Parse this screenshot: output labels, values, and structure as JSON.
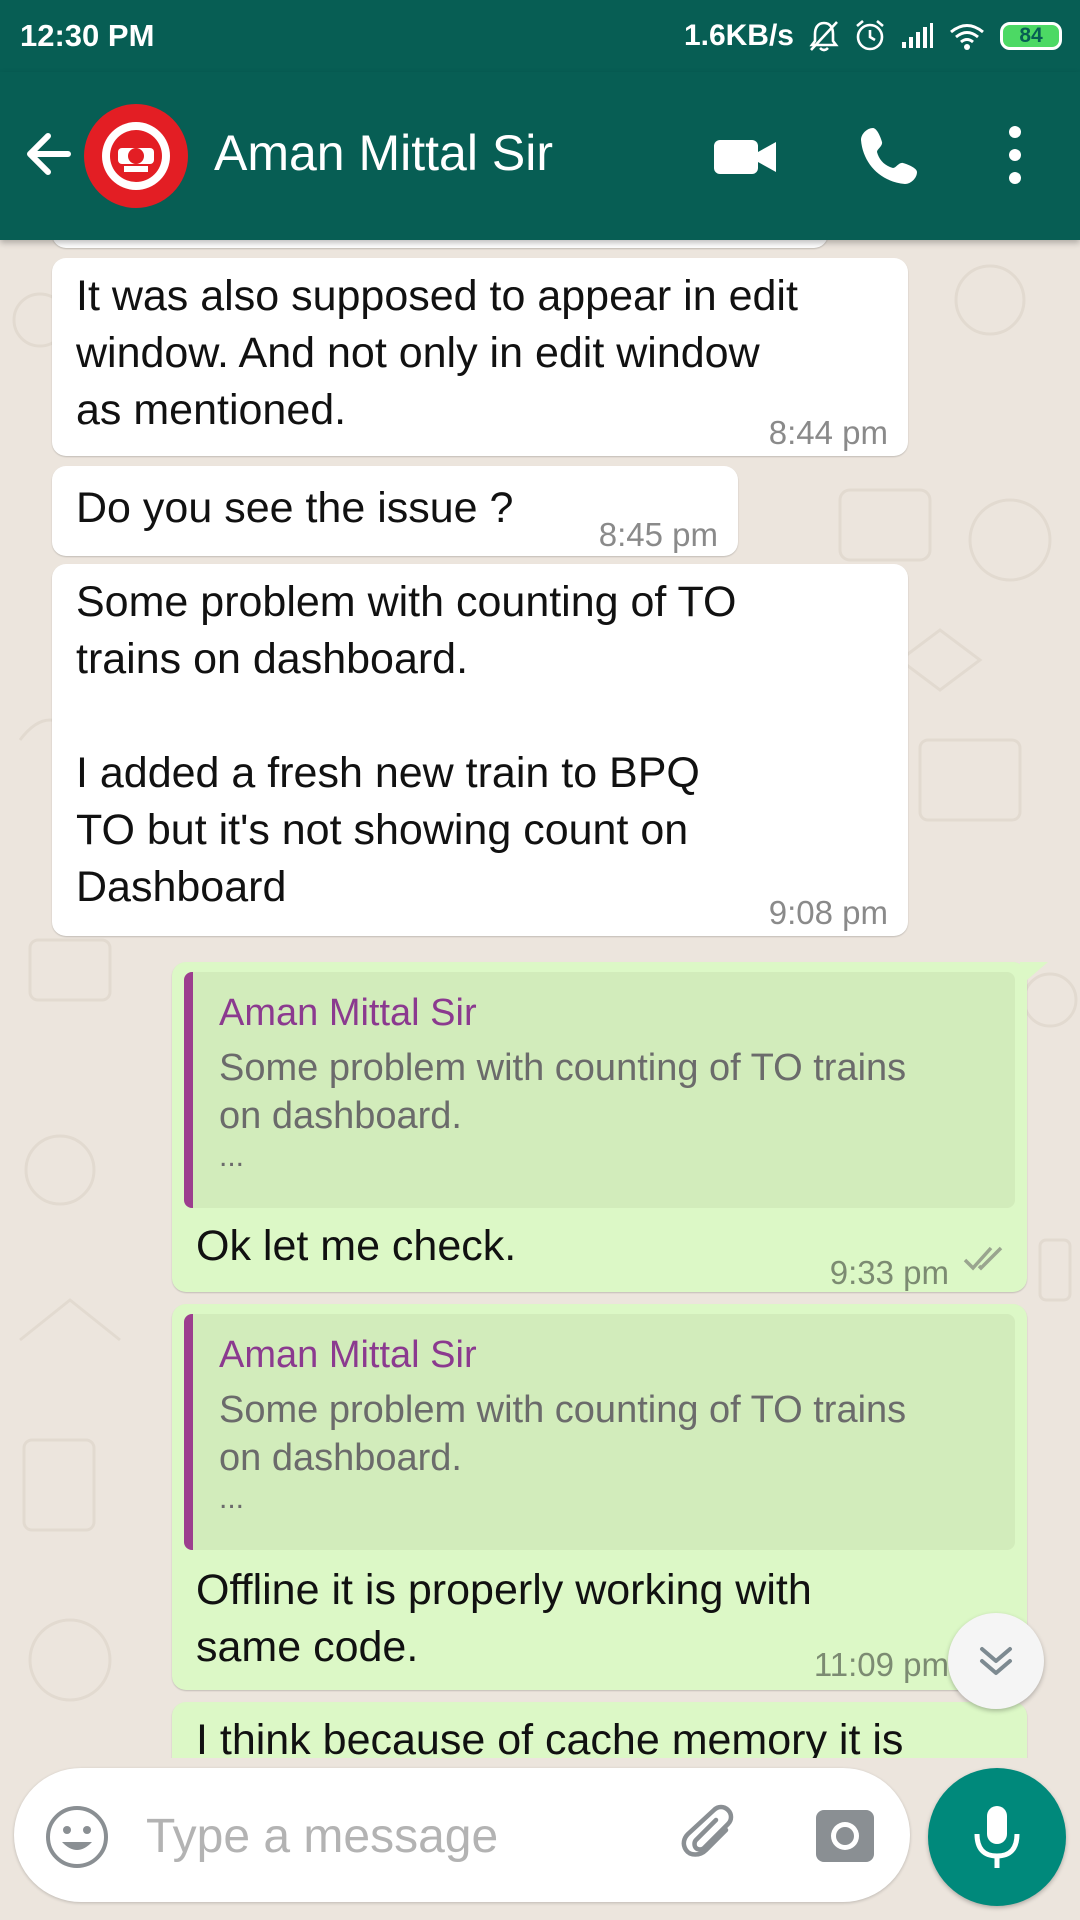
{
  "status_bar": {
    "time": "12:30 PM",
    "network_speed": "1.6KB/s",
    "battery": "84",
    "icons": [
      "muted-bell-icon",
      "alarm-icon",
      "signal-icon",
      "wifi-icon",
      "battery-icon"
    ]
  },
  "header": {
    "contact_name": "Aman Mittal Sir",
    "icons": [
      "back-arrow-icon",
      "avatar-indian-railways-logo",
      "video-call-icon",
      "phone-icon",
      "more-vert-icon"
    ]
  },
  "messages": [
    {
      "direction": "in",
      "text": "It was also supposed to appear in edit\nwindow. And not only in edit window\nas mentioned.",
      "time": "8:44 pm"
    },
    {
      "direction": "in",
      "text": "Do you see the issue ?",
      "time": "8:45 pm"
    },
    {
      "direction": "in",
      "text": "Some problem with counting of TO\ntrains on dashboard.\n\nI added a fresh new train to BPQ\nTO but it's not showing count on\nDashboard",
      "time": "9:08 pm"
    },
    {
      "direction": "out",
      "quote_author": "Aman Mittal Sir",
      "quote_text": "Some problem with counting of TO trains\non dashboard.",
      "quote_more": "...",
      "text": "Ok let me check.",
      "time": "9:33 pm"
    },
    {
      "direction": "out",
      "quote_author": "Aman Mittal Sir",
      "quote_text": "Some problem with counting of TO trains\non dashboard.",
      "quote_more": "...",
      "text": "Offline it is properly working with\nsame code.",
      "time": "11:09 pm"
    },
    {
      "direction": "out",
      "text": "I think because of cache memory it is",
      "time": ""
    }
  ],
  "composer": {
    "placeholder": "Type a message",
    "icons": [
      "emoji-icon",
      "attach-icon",
      "camera-icon",
      "mic-icon"
    ]
  },
  "colors": {
    "header": "#075e54",
    "chat_background": "#ece5dd",
    "incoming_bubble": "#ffffff",
    "outgoing_bubble": "#dcf8c6",
    "quote_author": "#8b3a8f",
    "mic_button": "#00897b"
  }
}
